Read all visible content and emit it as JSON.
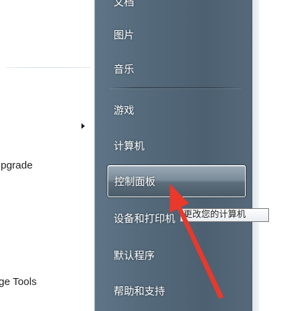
{
  "left_pane": {
    "items": [
      {
        "label": "pgrade"
      },
      {
        "label": "ge Tools"
      }
    ]
  },
  "start_menu": {
    "items_top": [
      {
        "label": "文档"
      },
      {
        "label": "图片"
      },
      {
        "label": "音乐"
      }
    ],
    "items_mid": [
      {
        "label": "游戏"
      },
      {
        "label": "计算机"
      },
      {
        "label": "控制面板"
      },
      {
        "label": "设备和打印机"
      },
      {
        "label": "默认程序"
      },
      {
        "label": "帮助和支持"
      }
    ]
  },
  "tooltip": {
    "text": "更改您的计算机"
  },
  "annotation": {
    "color": "#e8392b"
  }
}
